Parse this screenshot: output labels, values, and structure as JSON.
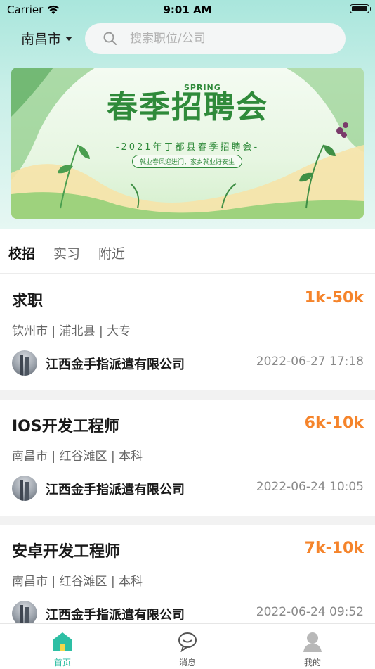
{
  "status_bar": {
    "carrier": "Carrier",
    "time": "9:01 AM"
  },
  "header": {
    "city": "南昌市",
    "search_placeholder": "搜索职位/公司"
  },
  "banner": {
    "title": "春季招聘会",
    "spring": "SPRING",
    "subtitle": "-2021年于都县春季招聘会-",
    "slogan": "就业春风迎进门，家乡就业好安生"
  },
  "tabs": [
    {
      "label": "校招",
      "active": true
    },
    {
      "label": "实习",
      "active": false
    },
    {
      "label": "附近",
      "active": false
    }
  ],
  "jobs": [
    {
      "title": "求职",
      "salary": "1k-50k",
      "location": "钦州市 | 浦北县 | 大专",
      "company": "江西金手指派遣有限公司",
      "date": "2022-06-27 17:18"
    },
    {
      "title": "IOS开发工程师",
      "salary": "6k-10k",
      "location": "南昌市 | 红谷滩区 | 本科",
      "company": "江西金手指派遣有限公司",
      "date": "2022-06-24 10:05"
    },
    {
      "title": "安卓开发工程师",
      "salary": "7k-10k",
      "location": "南昌市 | 红谷滩区 | 本科",
      "company": "江西金手指派遣有限公司",
      "date": "2022-06-24 09:52"
    }
  ],
  "tabbar": [
    {
      "label": "首页",
      "icon": "home-icon",
      "active": true
    },
    {
      "label": "消息",
      "icon": "message-icon",
      "active": false
    },
    {
      "label": "我的",
      "icon": "profile-icon",
      "active": false
    }
  ],
  "colors": {
    "accent": "#2dbfa4",
    "salary": "#f5842b",
    "banner_green": "#2f8a3a"
  }
}
